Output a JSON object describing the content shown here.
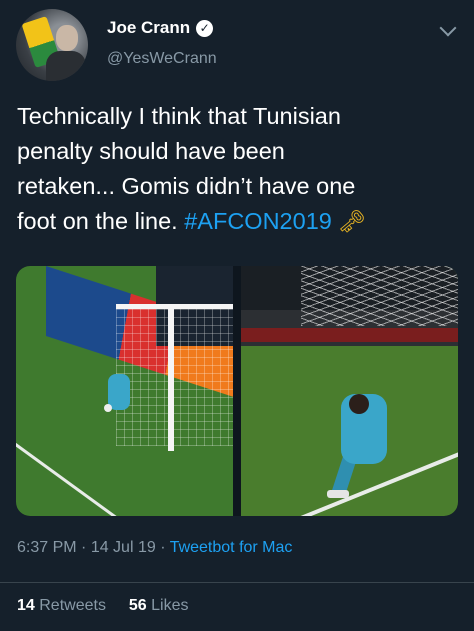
{
  "author": {
    "display_name": "Joe Crann",
    "handle": "@YesWeCrann",
    "verified_icon": "verified-badge-icon",
    "menu_icon": "chevron-down-icon"
  },
  "tweet": {
    "text_lines": [
      "Technically I think that Tunisian",
      "penalty should have been",
      "retaken... Gomis didn’t have one",
      "foot on the line. "
    ],
    "hashtag": "#AFCON2019",
    "emoji_icon": "key-icon"
  },
  "media": {
    "photos": [
      {
        "description_icon": "photo-goalkeeper-line-left"
      },
      {
        "description_icon": "photo-goalkeeper-line-right"
      }
    ]
  },
  "meta": {
    "time": "6:37 PM",
    "separator": " · ",
    "date": "14 Jul 19",
    "source": "Tweetbot for Mac"
  },
  "stats": {
    "retweets_count": "14",
    "retweets_label": "Retweets",
    "likes_count": "56",
    "likes_label": "Likes"
  },
  "colors": {
    "background": "#15202b",
    "accent": "#1da1f2",
    "secondary_text": "#8899a6",
    "divider": "#38444d"
  }
}
